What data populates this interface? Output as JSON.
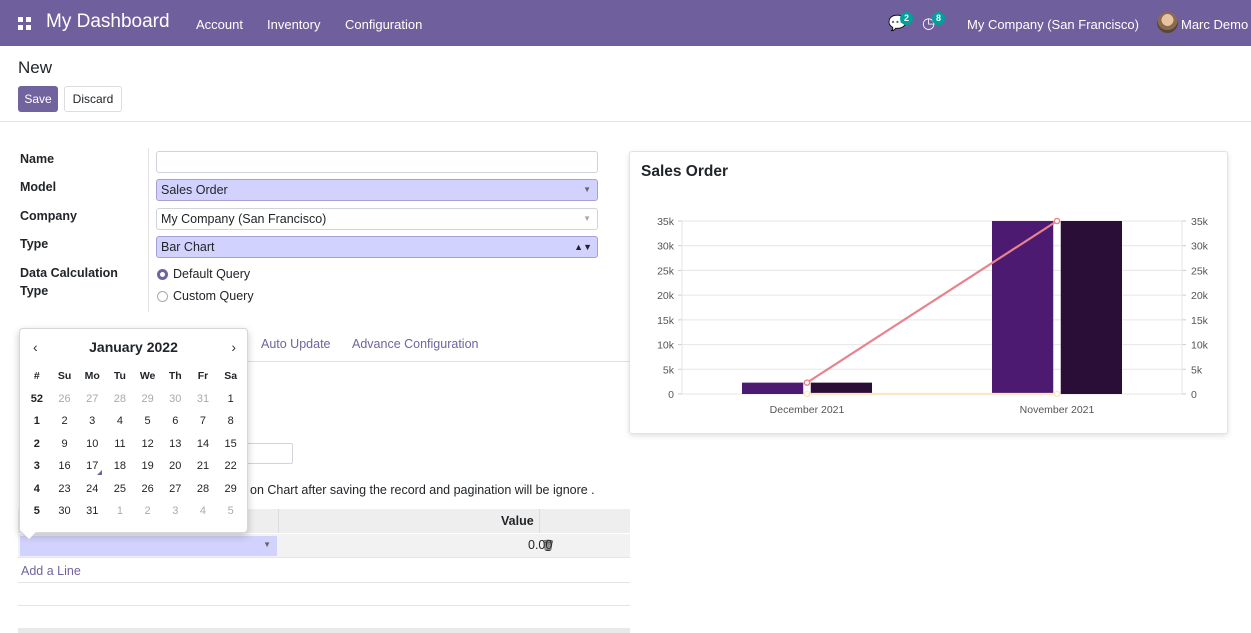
{
  "navbar": {
    "app_title": "My Dashboard",
    "menu": [
      "Account",
      "Inventory",
      "Configuration"
    ],
    "messages_count": "2",
    "activities_count": "8",
    "company": "My Company (San Francisco)",
    "user": "Marc Demo"
  },
  "control_panel": {
    "breadcrumb": "New",
    "save_label": "Save",
    "discard_label": "Discard"
  },
  "form": {
    "name_label": "Name",
    "name_value": "",
    "model_label": "Model",
    "model_value": "Sales Order",
    "company_label": "Company",
    "company_value": "My Company (San Francisco)",
    "type_label": "Type",
    "type_value": "Bar Chart",
    "calc_label_1": "Data Calculation",
    "calc_label_2": "Type",
    "calc_options": [
      "Default Query",
      "Custom Query"
    ],
    "calc_selected": "Default Query"
  },
  "tabs": [
    "Auto Update",
    "Advance Configuration"
  ],
  "info_text": "on Chart after saving the record and pagination will be ignore .",
  "table": {
    "value_header": "Value",
    "rows": [
      {
        "value": "0.00"
      }
    ],
    "add_line": "Add a Line"
  },
  "datepicker": {
    "title": "January 2022",
    "prev": "‹",
    "next": "›",
    "headers": [
      "#",
      "Su",
      "Mo",
      "Tu",
      "We",
      "Th",
      "Fr",
      "Sa"
    ],
    "weeks": [
      {
        "week": "52",
        "days": [
          "26",
          "27",
          "28",
          "29",
          "30",
          "31",
          "1"
        ],
        "muted": [
          true,
          true,
          true,
          true,
          true,
          true,
          false
        ]
      },
      {
        "week": "1",
        "days": [
          "2",
          "3",
          "4",
          "5",
          "6",
          "7",
          "8"
        ],
        "muted": [
          false,
          false,
          false,
          false,
          false,
          false,
          false
        ]
      },
      {
        "week": "2",
        "days": [
          "9",
          "10",
          "11",
          "12",
          "13",
          "14",
          "15"
        ],
        "muted": [
          false,
          false,
          false,
          false,
          false,
          false,
          false
        ]
      },
      {
        "week": "3",
        "days": [
          "16",
          "17",
          "18",
          "19",
          "20",
          "21",
          "22"
        ],
        "muted": [
          false,
          false,
          false,
          false,
          false,
          false,
          false
        ]
      },
      {
        "week": "4",
        "days": [
          "23",
          "24",
          "25",
          "26",
          "27",
          "28",
          "29"
        ],
        "muted": [
          false,
          false,
          false,
          false,
          false,
          false,
          false
        ]
      },
      {
        "week": "5",
        "days": [
          "30",
          "31",
          "1",
          "2",
          "3",
          "4",
          "5"
        ],
        "muted": [
          false,
          false,
          true,
          true,
          true,
          true,
          true
        ]
      }
    ],
    "today": "17"
  },
  "chart_data": {
    "type": "bar",
    "title": "Sales Order",
    "categories": [
      "December 2021",
      "November 2021"
    ],
    "series": [
      {
        "kind": "bar",
        "values": [
          2300,
          35000
        ],
        "color": "#4c1a70"
      },
      {
        "kind": "bar",
        "values": [
          2300,
          35000
        ],
        "color": "#2b0e38"
      },
      {
        "kind": "line",
        "values": [
          2300,
          35000
        ],
        "color": "#e8838d"
      },
      {
        "kind": "line",
        "values": [
          0,
          0
        ],
        "color": "#fde6c4"
      }
    ],
    "ylim": [
      0,
      35000
    ],
    "y_ticks": [
      "0",
      "5k",
      "10k",
      "15k",
      "20k",
      "25k",
      "30k",
      "35k"
    ],
    "grid": true,
    "dual_axis": true
  }
}
